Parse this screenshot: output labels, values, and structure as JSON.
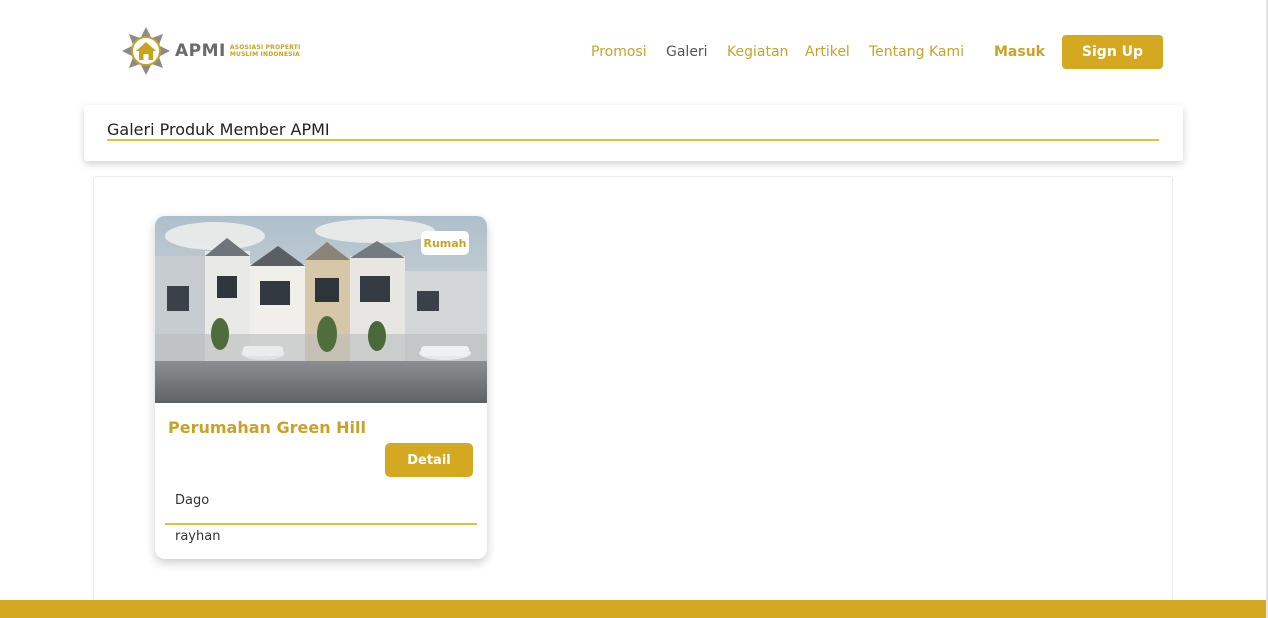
{
  "brand": {
    "name": "APMI",
    "subtitle_line1": "ASOSIASI PROPERTI",
    "subtitle_line2": "MUSLIM INDONESIA",
    "accent_color": "#d4a821"
  },
  "nav": {
    "items": [
      {
        "label": "Promosi"
      },
      {
        "label": "Galeri",
        "active": true
      },
      {
        "label": "Kegiatan"
      },
      {
        "label": "Artikel"
      },
      {
        "label": "Tentang Kami"
      }
    ],
    "login_label": "Masuk",
    "signup_label": "Sign Up"
  },
  "page": {
    "title": "Galeri Produk Member APMI"
  },
  "gallery": {
    "items": [
      {
        "category_badge": "Rumah",
        "title": "Perumahan Green Hill",
        "detail_label": "Detail",
        "location": "Dago",
        "member": "rayhan",
        "image": "house-render-image"
      }
    ]
  }
}
